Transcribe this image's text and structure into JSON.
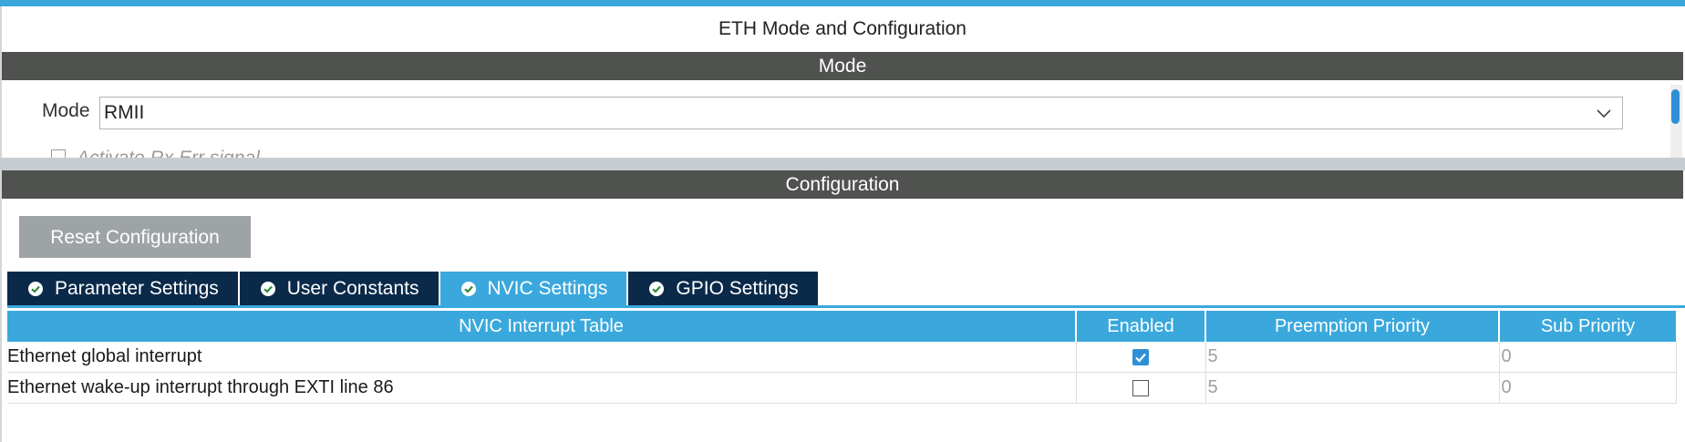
{
  "title": "ETH Mode and Configuration",
  "mode_section": {
    "header": "Mode",
    "mode_label": "Mode",
    "mode_value": "RMII",
    "partial_option_label": "Activate Rx Err signal"
  },
  "config_section": {
    "header": "Configuration",
    "reset_button": "Reset Configuration",
    "tabs": [
      {
        "label": "Parameter Settings",
        "active": false,
        "icon": "check-circle-icon"
      },
      {
        "label": "User Constants",
        "active": false,
        "icon": "check-circle-icon"
      },
      {
        "label": "NVIC Settings",
        "active": true,
        "icon": "check-circle-icon"
      },
      {
        "label": "GPIO Settings",
        "active": false,
        "icon": "check-circle-icon"
      }
    ],
    "table": {
      "columns": [
        "NVIC Interrupt Table",
        "Enabled",
        "Preemption Priority",
        "Sub Priority"
      ],
      "rows": [
        {
          "name": "Ethernet global interrupt",
          "enabled": true,
          "preemption": "5",
          "sub": "0"
        },
        {
          "name": "Ethernet wake-up interrupt through EXTI line 86",
          "enabled": false,
          "preemption": "5",
          "sub": "0"
        }
      ]
    }
  },
  "colors": {
    "accent": "#3aa8dc",
    "section_bar": "#505250",
    "tab_inactive": "#0b2a4a",
    "button_disabled": "#9ea3a6"
  }
}
